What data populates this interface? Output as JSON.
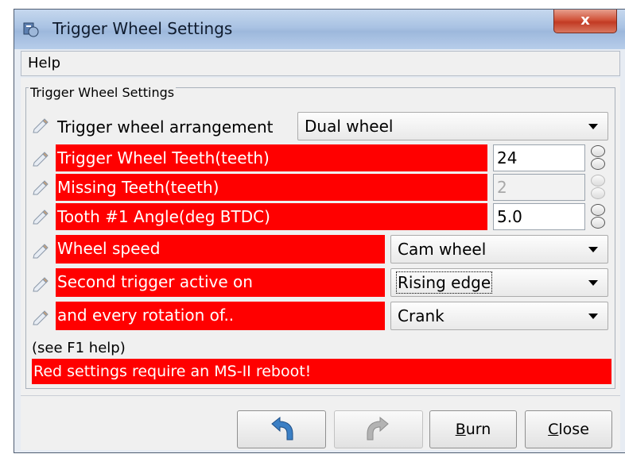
{
  "window": {
    "title": "Trigger Wheel Settings",
    "close_glyph": "x"
  },
  "menu": {
    "help": "Help"
  },
  "group": {
    "legend": "Trigger Wheel Settings"
  },
  "rows": {
    "arrangement": {
      "label": "Trigger wheel arrangement",
      "value": "Dual wheel"
    },
    "teeth": {
      "label": "Trigger Wheel Teeth(teeth)",
      "value": "24"
    },
    "missing": {
      "label": "Missing Teeth(teeth)",
      "value": "2"
    },
    "angle": {
      "label": "Tooth #1 Angle(deg BTDC)",
      "value": "5.0"
    },
    "speed": {
      "label": "Wheel speed",
      "value": "Cam wheel"
    },
    "second": {
      "label": "Second trigger active on",
      "value": "Rising edge"
    },
    "rotation": {
      "label": "and every rotation of..",
      "value": "Crank"
    }
  },
  "hint": "(see F1 help)",
  "warning": "Red settings require an MS-II reboot!",
  "buttons": {
    "burn": {
      "label_first": "B",
      "label_rest": "urn"
    },
    "close": {
      "label_first": "C",
      "label_rest": "lose"
    }
  },
  "colors": {
    "required_reboot": "#ff0000",
    "accent": "#3b7fc4"
  },
  "icons": [
    "app-icon",
    "close-icon",
    "pencil-icon",
    "undo-icon",
    "redo-icon",
    "spinner-icon",
    "chevron-down-icon"
  ]
}
